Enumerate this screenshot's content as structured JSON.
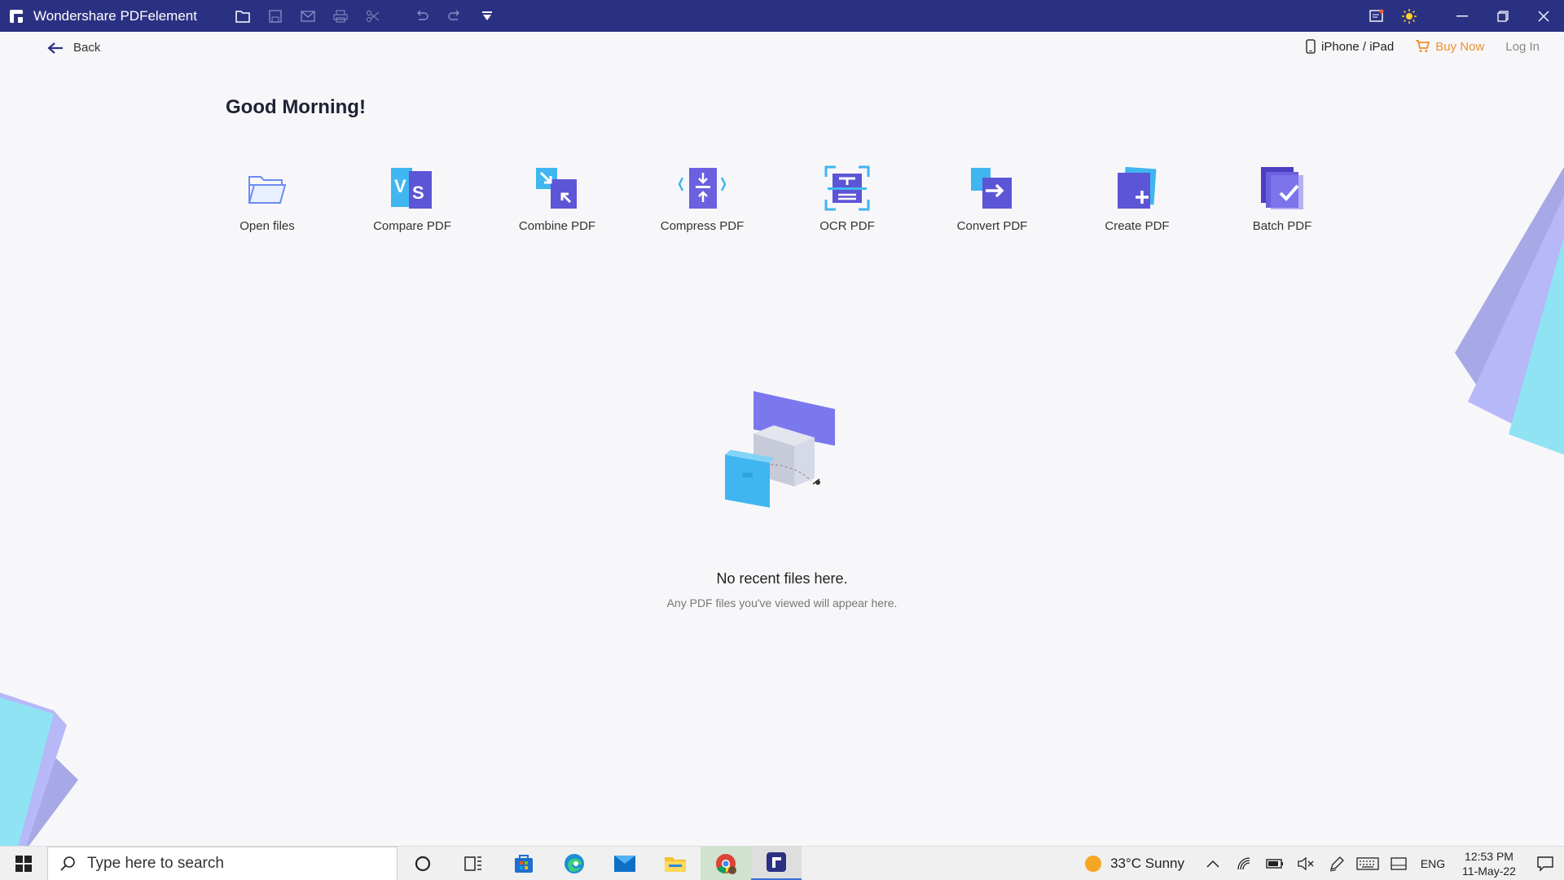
{
  "titlebar": {
    "app_title": "Wondershare PDFelement",
    "tools": [
      "folder-icon",
      "save-icon",
      "mail-icon",
      "print-icon",
      "scissors-icon",
      "undo-icon",
      "redo-icon",
      "dropdown-icon"
    ],
    "colors": {
      "bg": "#2b3182"
    }
  },
  "subhead": {
    "back_label": "Back",
    "device_label": "iPhone / iPad",
    "buy_label": "Buy Now",
    "login_label": "Log In"
  },
  "greeting": "Good Morning!",
  "tools": [
    {
      "label": "Open files",
      "icon": "open-folder-icon"
    },
    {
      "label": "Compare PDF",
      "icon": "compare-icon"
    },
    {
      "label": "Combine PDF",
      "icon": "combine-icon"
    },
    {
      "label": "Compress PDF",
      "icon": "compress-icon"
    },
    {
      "label": "OCR PDF",
      "icon": "ocr-icon"
    },
    {
      "label": "Convert PDF",
      "icon": "convert-icon"
    },
    {
      "label": "Create PDF",
      "icon": "create-icon"
    },
    {
      "label": "Batch PDF",
      "icon": "batch-icon"
    }
  ],
  "empty_state": {
    "title": "No recent files here.",
    "subtitle": "Any PDF files you've viewed will appear here."
  },
  "taskbar": {
    "search_placeholder": "Type here to search",
    "weather": "33°C  Sunny",
    "language": "ENG",
    "time": "12:53 PM",
    "date": "11-May-22"
  }
}
